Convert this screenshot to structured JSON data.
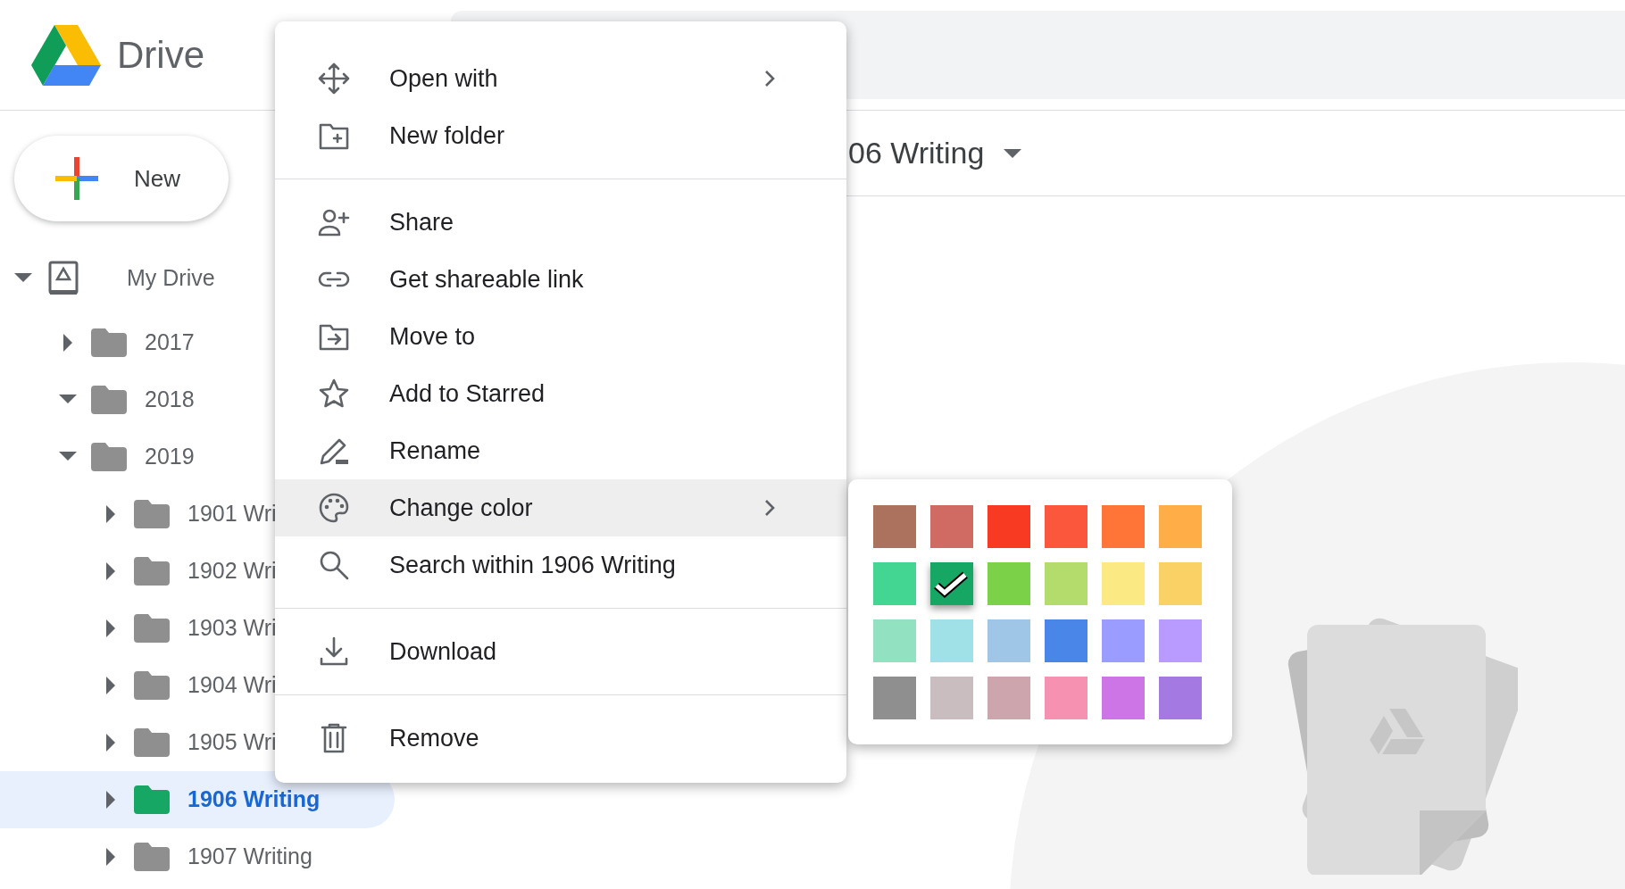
{
  "header": {
    "app_name": "Drive"
  },
  "new_button": {
    "label": "New"
  },
  "sidebar": {
    "tree": [
      {
        "label": "My Drive",
        "kind": "drive",
        "expanded": true,
        "selected": false,
        "children": [
          {
            "label": "2017",
            "kind": "folder",
            "color": "#8f8f8f",
            "expanded": false,
            "selected": false
          },
          {
            "label": "2018",
            "kind": "folder",
            "color": "#8f8f8f",
            "expanded": true,
            "selected": false
          },
          {
            "label": "2019",
            "kind": "folder",
            "color": "#8f8f8f",
            "expanded": true,
            "selected": false,
            "children": [
              {
                "label": "1901 Wri",
                "kind": "folder",
                "color": "#8f8f8f",
                "expanded": false,
                "selected": false
              },
              {
                "label": "1902 Wri",
                "kind": "folder",
                "color": "#8f8f8f",
                "expanded": false,
                "selected": false
              },
              {
                "label": "1903 Wri",
                "kind": "folder",
                "color": "#8f8f8f",
                "expanded": false,
                "selected": false
              },
              {
                "label": "1904 Wri",
                "kind": "folder",
                "color": "#8f8f8f",
                "expanded": false,
                "selected": false
              },
              {
                "label": "1905 Wri",
                "kind": "folder",
                "color": "#8f8f8f",
                "expanded": false,
                "selected": false
              },
              {
                "label": "1906 Writing",
                "kind": "folder",
                "color": "#16a765",
                "expanded": false,
                "selected": true
              },
              {
                "label": "1907 Writing",
                "kind": "folder",
                "color": "#8f8f8f",
                "expanded": false,
                "selected": false
              }
            ]
          }
        ]
      }
    ]
  },
  "content": {
    "title": "06 Writing"
  },
  "context_menu": {
    "groups": [
      [
        {
          "label": "Open with",
          "has_submenu": true,
          "highlighted": false
        },
        {
          "label": "New folder",
          "has_submenu": false,
          "highlighted": false
        }
      ],
      [
        {
          "label": "Share",
          "has_submenu": false,
          "highlighted": false
        },
        {
          "label": "Get shareable link",
          "has_submenu": false,
          "highlighted": false
        },
        {
          "label": "Move to",
          "has_submenu": false,
          "highlighted": false
        },
        {
          "label": "Add to Starred",
          "has_submenu": false,
          "highlighted": false
        },
        {
          "label": "Rename",
          "has_submenu": false,
          "highlighted": false
        },
        {
          "label": "Change color",
          "has_submenu": true,
          "highlighted": true
        },
        {
          "label": "Search within 1906 Writing",
          "has_submenu": false,
          "highlighted": false
        }
      ],
      [
        {
          "label": "Download",
          "has_submenu": false,
          "highlighted": false
        }
      ],
      [
        {
          "label": "Remove",
          "has_submenu": false,
          "highlighted": false
        }
      ]
    ]
  },
  "color_palette": {
    "swatches": [
      {
        "color": "#ac725e",
        "selected": false
      },
      {
        "color": "#d06b64",
        "selected": false
      },
      {
        "color": "#f83a22",
        "selected": false
      },
      {
        "color": "#fa573c",
        "selected": false
      },
      {
        "color": "#ff7537",
        "selected": false
      },
      {
        "color": "#ffad46",
        "selected": false
      },
      {
        "color": "#42d692",
        "selected": false
      },
      {
        "color": "#16a765",
        "selected": true
      },
      {
        "color": "#7bd148",
        "selected": false
      },
      {
        "color": "#b3dc6c",
        "selected": false
      },
      {
        "color": "#fbe983",
        "selected": false
      },
      {
        "color": "#fad165",
        "selected": false
      },
      {
        "color": "#92e1c0",
        "selected": false
      },
      {
        "color": "#9fe1e7",
        "selected": false
      },
      {
        "color": "#9fc6e7",
        "selected": false
      },
      {
        "color": "#4986e7",
        "selected": false
      },
      {
        "color": "#9a9cff",
        "selected": false
      },
      {
        "color": "#b99aff",
        "selected": false
      },
      {
        "color": "#8f8f8f",
        "selected": false
      },
      {
        "color": "#cabdbf",
        "selected": false
      },
      {
        "color": "#cca6ac",
        "selected": false
      },
      {
        "color": "#f691b2",
        "selected": false
      },
      {
        "color": "#cd74e6",
        "selected": false
      },
      {
        "color": "#a47ae2",
        "selected": false
      }
    ]
  }
}
